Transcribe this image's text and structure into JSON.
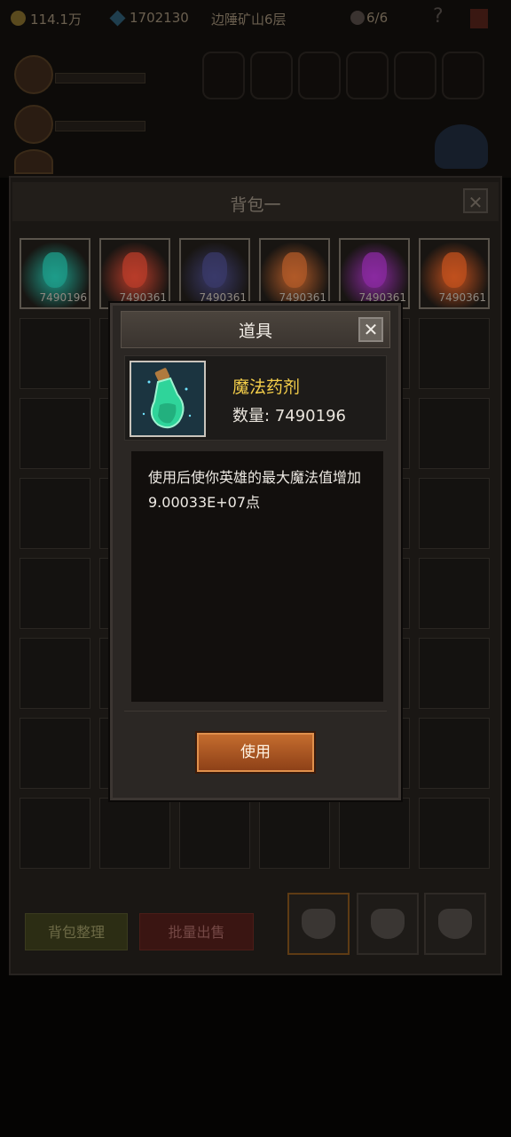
{
  "hud": {
    "gold": "114.1万",
    "diamonds": "1702130",
    "location": "边陲矿山6层",
    "skull_count": "6/6",
    "help": "?"
  },
  "bag": {
    "title": "背包一",
    "close": "✕",
    "items": [
      {
        "count": "7490196",
        "color": "#1d9c8a"
      },
      {
        "count": "7490361",
        "color": "#b83c2a"
      },
      {
        "count": "7490361",
        "color": "#3a3a6a"
      },
      {
        "count": "7490361",
        "color": "#b05a28"
      },
      {
        "count": "7490361",
        "color": "#8a2aa0"
      },
      {
        "count": "7490361",
        "color": "#c0501e"
      }
    ],
    "sort_button": "背包整理",
    "sell_button": "批量出售"
  },
  "dialog": {
    "title": "道具",
    "close": "✕",
    "item_name": "魔法药剂",
    "quantity_label": "数量:",
    "quantity_value": "7490196",
    "description": "使用后使你英雄的最大魔法值增加9.00033E+07点",
    "use_button": "使用"
  },
  "colors": {
    "item_name": "#f5cf4a",
    "use_button": "#c46c2e"
  }
}
